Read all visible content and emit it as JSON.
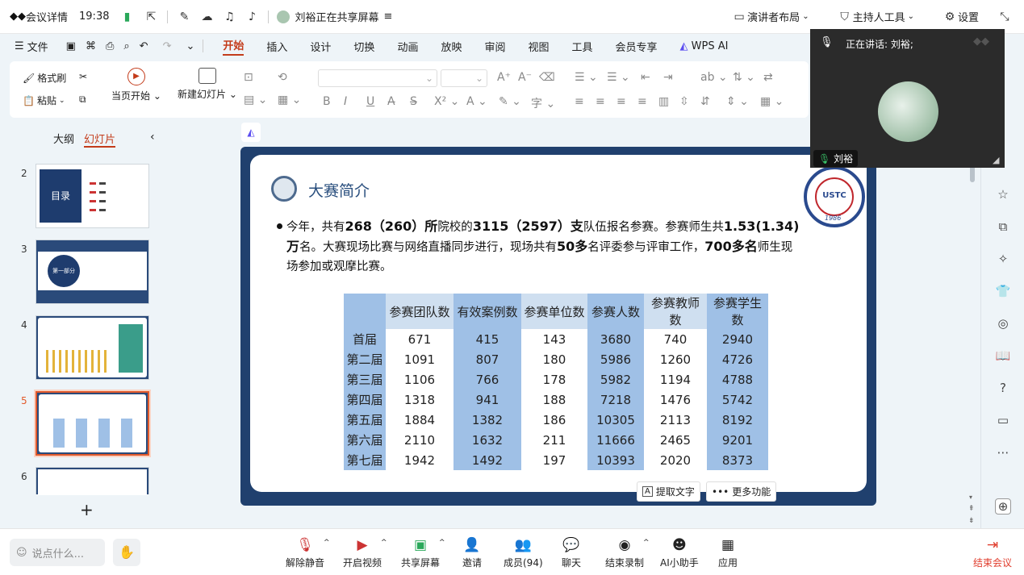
{
  "topbar": {
    "meeting_details": "会议详情",
    "time": "19:38",
    "sharing_status": "刘裕正在共享屏幕",
    "presenter_layout": "演讲者布局",
    "host_tools": "主持人工具",
    "settings": "设置"
  },
  "ribbon_tabs": [
    "文件",
    "开始",
    "插入",
    "设计",
    "切换",
    "动画",
    "放映",
    "审阅",
    "视图",
    "工具",
    "会员专享",
    "WPS AI"
  ],
  "ribbon": {
    "format_brush": "格式刷",
    "paste": "粘贴",
    "play_current": "当页开始",
    "new_slide": "新建幻灯片"
  },
  "left_panel": {
    "tab_outline": "大纲",
    "tab_slides": "幻灯片",
    "slides": [
      "2",
      "3",
      "4",
      "5",
      "6"
    ],
    "thumb2_title": "目录",
    "thumb3_label": "第一部分",
    "add": "+"
  },
  "slide": {
    "title": "大赛简介",
    "p_1": "今年，共有",
    "p_2": "268（260）所",
    "p_3": "院校的",
    "p_4": "3115（2597）支",
    "p_5": "队伍报名参赛。参赛师生共",
    "p_6": "1.53(1.34)万",
    "p_7": "名。大赛现场比赛与网络直播同步进行，现场共有",
    "p_8": "50多",
    "p_9": "名评委参与评审工作，",
    "p_10": "700多名",
    "p_11": "师生现场参加或观摩比赛。",
    "logo_text": "USTC",
    "logo_year": "1986",
    "table_headers": [
      "",
      "参赛团队数",
      "有效案例数",
      "参赛单位数",
      "参赛人数",
      "参赛教师数",
      "参赛学生数"
    ],
    "table_rows": [
      [
        "首届",
        "671",
        "415",
        "143",
        "3680",
        "740",
        "2940"
      ],
      [
        "第二届",
        "1091",
        "807",
        "180",
        "5986",
        "1260",
        "4726"
      ],
      [
        "第三届",
        "1106",
        "766",
        "178",
        "5982",
        "1194",
        "4788"
      ],
      [
        "第四届",
        "1318",
        "941",
        "188",
        "7218",
        "1476",
        "5742"
      ],
      [
        "第五届",
        "1884",
        "1382",
        "186",
        "10305",
        "2113",
        "8192"
      ],
      [
        "第六届",
        "2110",
        "1632",
        "211",
        "11666",
        "2465",
        "9201"
      ],
      [
        "第七届",
        "1942",
        "1492",
        "197",
        "10393",
        "2020",
        "8373"
      ]
    ]
  },
  "floating": {
    "extract_text": "提取文字",
    "more_functions": "更多功能"
  },
  "video": {
    "speaking": "正在讲话:  刘裕;",
    "name": "刘裕"
  },
  "bottombar": {
    "chat_placeholder": "说点什么...",
    "unmute": "解除静音",
    "start_video": "开启视频",
    "share_screen": "共享屏幕",
    "invite": "邀请",
    "members": "成员(94)",
    "chat": "聊天",
    "end_record": "结束录制",
    "ai_assistant": "AI小助手",
    "apps": "应用",
    "end_meeting": "结束会议"
  },
  "colors": {
    "accent": "#c33b1a",
    "slide_border": "#20406e",
    "table_blue": "#9fc0e6",
    "end_red": "#e03c2c"
  }
}
